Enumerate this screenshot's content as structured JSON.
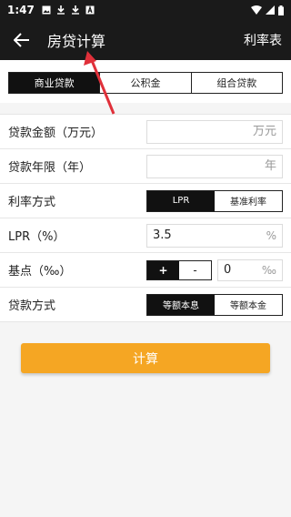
{
  "status_bar": {
    "time": "1:47"
  },
  "app_bar": {
    "title": "房贷计算",
    "action": "利率表"
  },
  "loan_type_tabs": [
    {
      "label": "商业贷款",
      "active": true
    },
    {
      "label": "公积金",
      "active": false
    },
    {
      "label": "组合贷款",
      "active": false
    }
  ],
  "form": {
    "amount": {
      "label": "贷款金额（万元）",
      "placeholder": "万元"
    },
    "years": {
      "label": "贷款年限（年）",
      "placeholder": "年"
    },
    "rate_mode": {
      "label": "利率方式",
      "options": [
        "LPR",
        "基准利率"
      ],
      "selected": "LPR"
    },
    "lpr": {
      "label": "LPR（%）",
      "value": "3.5",
      "unit": "%"
    },
    "basis_points": {
      "label": "基点（‰）",
      "plus": "+",
      "minus": "-",
      "value": "0",
      "unit": "‰"
    },
    "repay_method": {
      "label": "贷款方式",
      "options": [
        "等额本息",
        "等额本金"
      ],
      "selected": "等额本息"
    }
  },
  "calculate_button": "计算",
  "colors": {
    "accent": "#f5a623",
    "dark": "#1a1a1a",
    "annotation": "#e0303a"
  }
}
